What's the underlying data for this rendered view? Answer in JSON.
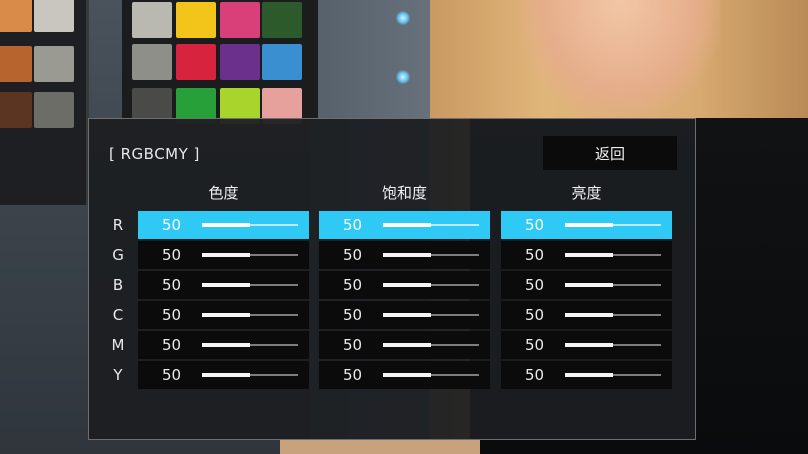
{
  "panel": {
    "title": "[ RGBCMY ]",
    "back_label": "返回"
  },
  "columns": [
    {
      "header": "色度"
    },
    {
      "header": "饱和度"
    },
    {
      "header": "亮度"
    }
  ],
  "rows": [
    {
      "label": "R",
      "values": [
        "50",
        "50",
        "50"
      ],
      "levels": [
        0.5,
        0.5,
        0.5
      ]
    },
    {
      "label": "G",
      "values": [
        "50",
        "50",
        "50"
      ],
      "levels": [
        0.5,
        0.5,
        0.5
      ]
    },
    {
      "label": "B",
      "values": [
        "50",
        "50",
        "50"
      ],
      "levels": [
        0.5,
        0.5,
        0.5
      ]
    },
    {
      "label": "C",
      "values": [
        "50",
        "50",
        "50"
      ],
      "levels": [
        0.5,
        0.5,
        0.5
      ]
    },
    {
      "label": "M",
      "values": [
        "50",
        "50",
        "50"
      ],
      "levels": [
        0.5,
        0.5,
        0.5
      ]
    },
    {
      "label": "Y",
      "values": [
        "50",
        "50",
        "50"
      ],
      "levels": [
        0.5,
        0.5,
        0.5
      ]
    }
  ],
  "selected_row": 0,
  "colors": {
    "selected": "#2ec9f4",
    "cell_bg": "#0b0b0c",
    "panel_bg": "#1c1e21"
  },
  "background_swatches": [
    {
      "color": "#d98b4a"
    },
    {
      "color": "#c9c6bf"
    },
    {
      "color": "#b8642e"
    },
    {
      "color": "#9a9a92"
    },
    {
      "color": "#5b3422"
    },
    {
      "color": "#6d6d68"
    },
    {
      "color": "#b9b9b2"
    },
    {
      "color": "#f3c51a"
    },
    {
      "color": "#d93f78"
    },
    {
      "color": "#2d5a2a"
    },
    {
      "color": "#8f8f8a"
    },
    {
      "color": "#d8233f"
    },
    {
      "color": "#6b2f8c"
    },
    {
      "color": "#3a8fd0"
    },
    {
      "color": "#4a4a48"
    },
    {
      "color": "#27a03a"
    },
    {
      "color": "#a9d42b"
    },
    {
      "color": "#e6a19c"
    }
  ]
}
